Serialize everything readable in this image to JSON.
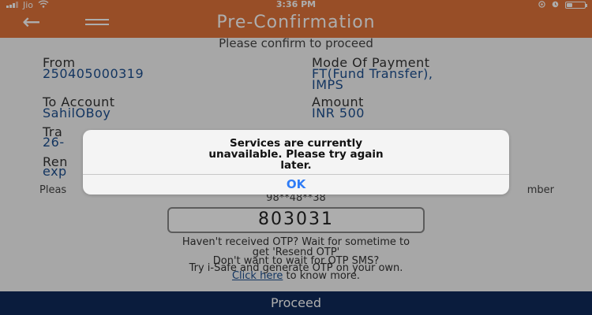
{
  "status_bar": {
    "carrier": "Jio",
    "time": "3:36 PM",
    "battery_level": 0.3,
    "icons": [
      "signal-icon",
      "wifi-icon",
      "location-icon",
      "alarm-icon",
      "battery-icon"
    ]
  },
  "header": {
    "title": "Pre-Confirmation",
    "back_icon": "back-arrow-icon",
    "menu_icon": "hamburger-menu-icon"
  },
  "confirm": {
    "text": "Please confirm to proceed"
  },
  "details": {
    "from_label": "From",
    "from_value": "250405000319",
    "mode_label": "Mode Of Payment",
    "mode_value_line1": "FT(Fund Transfer),",
    "mode_value_line2": "IMPS",
    "to_label": "To Account",
    "to_value": "SahilOBoy",
    "amount_label": "Amount",
    "amount_value": "INR 500",
    "date_label_partial": "Tra",
    "date_value_partial": "26-",
    "remarks_label_partial": "Ren",
    "remarks_value_partial": "exp"
  },
  "otp": {
    "note_left": "Pleas",
    "note_right": "mber",
    "masked_number": "98**48**38",
    "code": "803031",
    "not_received_line1": "Haven't received OTP? Wait for sometime to",
    "not_received_line2": "get 'Resend OTP'",
    "wait_line1": "Don't want to wait for OTP SMS?",
    "wait_line2": "Try i-Safe and generate OTP on your own.",
    "click_here": "Click here",
    "know_more": " to know more."
  },
  "footer": {
    "proceed_label": "Proceed"
  },
  "alert": {
    "message_line1": "Services are currently",
    "message_line2": "unavailable. Please try again",
    "message_line3": "later.",
    "ok_label": "OK"
  },
  "colors": {
    "header": "#e1733a",
    "link": "#1c4f8f",
    "footer": "#0f2a5a",
    "alert_button": "#2f7cf6"
  }
}
